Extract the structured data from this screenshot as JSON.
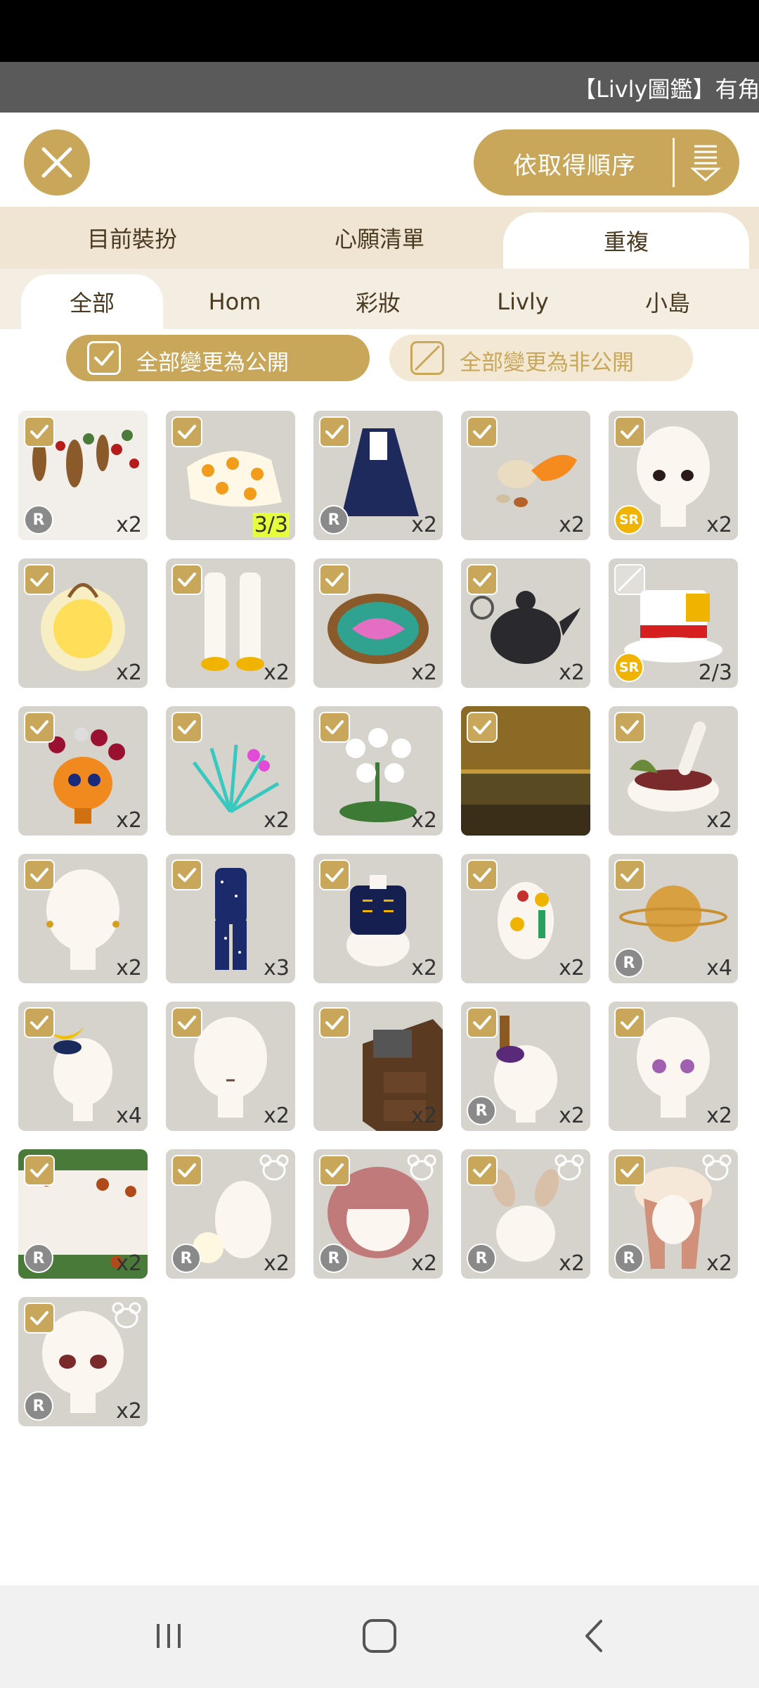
{
  "header": {
    "marquee": "【Livly圖鑑】有角",
    "sort_label": "依取得順序",
    "icons": [
      "close-icon",
      "sort-order-icon"
    ]
  },
  "tabs": [
    {
      "label": "目前裝扮"
    },
    {
      "label": "心願清單"
    },
    {
      "label": "重複",
      "active": true
    }
  ],
  "subtabs": [
    {
      "label": "全部",
      "active": true
    },
    {
      "label": "Hom"
    },
    {
      "label": "彩妝"
    },
    {
      "label": "Livly"
    },
    {
      "label": "小島"
    }
  ],
  "actions": {
    "public_all": "全部變更為公開",
    "private_all": "全部變更為非公開"
  },
  "items": [
    {
      "name": "hanging-berries-garland",
      "checked": true,
      "rarity": "R",
      "count": "x2"
    },
    {
      "name": "orange-pattern-cloth",
      "checked": true,
      "count": "3/3",
      "highlight": true
    },
    {
      "name": "navy-cape",
      "checked": true,
      "rarity": "R",
      "count": "x2"
    },
    {
      "name": "spilled-jar-orange",
      "checked": true,
      "count": "x2"
    },
    {
      "name": "eyes-dark",
      "checked": true,
      "rarity": "SR",
      "count": "x2"
    },
    {
      "name": "glowing-lantern",
      "checked": true,
      "count": "x2"
    },
    {
      "name": "white-leg-warmers",
      "checked": true,
      "count": "x2"
    },
    {
      "name": "moon-mirror",
      "checked": true,
      "count": "x2"
    },
    {
      "name": "black-teapot",
      "checked": true,
      "count": "x2"
    },
    {
      "name": "carnival-hat",
      "checked": false,
      "rarity": "SR",
      "count": "2/3"
    },
    {
      "name": "skull-flower-vase",
      "checked": true,
      "count": "x2"
    },
    {
      "name": "glowing-grass",
      "checked": true,
      "count": "x2"
    },
    {
      "name": "white-flowers",
      "checked": true,
      "count": "x2"
    },
    {
      "name": "sunset-sea-background",
      "checked": true,
      "count": ""
    },
    {
      "name": "mortar-bowl",
      "checked": true,
      "count": "x2"
    },
    {
      "name": "earrings-gold",
      "checked": true,
      "count": "x2"
    },
    {
      "name": "starry-pajamas",
      "checked": true,
      "count": "x3"
    },
    {
      "name": "navy-vest",
      "checked": true,
      "count": "x2"
    },
    {
      "name": "medals-torso",
      "checked": true,
      "count": "x2"
    },
    {
      "name": "golden-planet",
      "checked": true,
      "rarity": "R",
      "count": "x4"
    },
    {
      "name": "moon-headpiece",
      "checked": true,
      "count": "x4"
    },
    {
      "name": "small-mouth",
      "checked": true,
      "count": "x2"
    },
    {
      "name": "wood-cabinet-projector",
      "checked": true,
      "count": "x2"
    },
    {
      "name": "purple-pipe-hat",
      "checked": true,
      "rarity": "R",
      "count": "x2"
    },
    {
      "name": "purple-eyes",
      "checked": true,
      "count": "x2"
    },
    {
      "name": "fruit-vine-frame",
      "checked": true,
      "rarity": "R",
      "count": "x2"
    },
    {
      "name": "fluffy-tail",
      "checked": true,
      "rarity": "R",
      "count": "x2",
      "bear": true
    },
    {
      "name": "pink-bob-hair",
      "checked": true,
      "rarity": "R",
      "count": "x2",
      "bear": true
    },
    {
      "name": "bunny-ears",
      "checked": true,
      "rarity": "R",
      "count": "x2",
      "bear": true
    },
    {
      "name": "long-pink-hair",
      "checked": true,
      "rarity": "R",
      "count": "x2",
      "bear": true
    },
    {
      "name": "brown-eyes",
      "checked": true,
      "rarity": "R",
      "count": "x2",
      "bear": true
    }
  ],
  "nav": {
    "icons": [
      "recent-apps-icon",
      "home-icon",
      "back-icon"
    ]
  }
}
